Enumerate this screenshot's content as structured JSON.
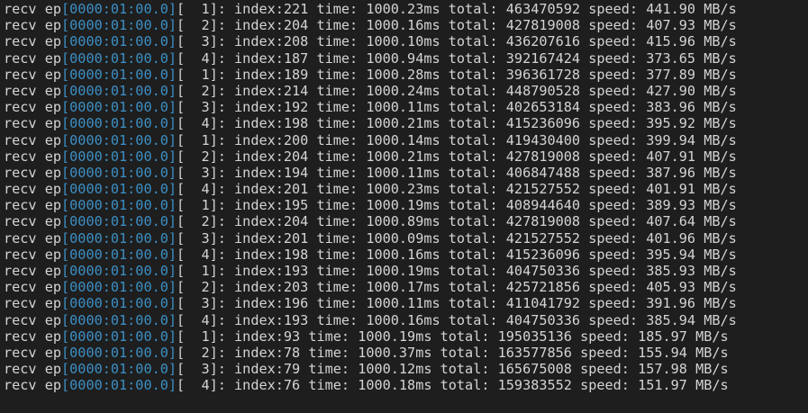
{
  "terminal": {
    "colors": {
      "background": "#1e1e1e",
      "text": "#d4d4d4",
      "bus_id": "#3c8fc4"
    },
    "lines": [
      {
        "prefix": "recv ep",
        "bus": "[0000:01:00.0]",
        "rest": "[  1]: index:221 time: 1000.23ms total: 463470592 speed: 441.90 MB/s"
      },
      {
        "prefix": "recv ep",
        "bus": "[0000:01:00.0]",
        "rest": "[  2]: index:204 time: 1000.16ms total: 427819008 speed: 407.93 MB/s"
      },
      {
        "prefix": "recv ep",
        "bus": "[0000:01:00.0]",
        "rest": "[  3]: index:208 time: 1000.10ms total: 436207616 speed: 415.96 MB/s"
      },
      {
        "prefix": "recv ep",
        "bus": "[0000:01:00.0]",
        "rest": "[  4]: index:187 time: 1000.94ms total: 392167424 speed: 373.65 MB/s"
      },
      {
        "prefix": "recv ep",
        "bus": "[0000:01:00.0]",
        "rest": "[  1]: index:189 time: 1000.28ms total: 396361728 speed: 377.89 MB/s"
      },
      {
        "prefix": "recv ep",
        "bus": "[0000:01:00.0]",
        "rest": "[  2]: index:214 time: 1000.24ms total: 448790528 speed: 427.90 MB/s"
      },
      {
        "prefix": "recv ep",
        "bus": "[0000:01:00.0]",
        "rest": "[  3]: index:192 time: 1000.11ms total: 402653184 speed: 383.96 MB/s"
      },
      {
        "prefix": "recv ep",
        "bus": "[0000:01:00.0]",
        "rest": "[  4]: index:198 time: 1000.21ms total: 415236096 speed: 395.92 MB/s"
      },
      {
        "prefix": "recv ep",
        "bus": "[0000:01:00.0]",
        "rest": "[  1]: index:200 time: 1000.14ms total: 419430400 speed: 399.94 MB/s"
      },
      {
        "prefix": "recv ep",
        "bus": "[0000:01:00.0]",
        "rest": "[  2]: index:204 time: 1000.21ms total: 427819008 speed: 407.91 MB/s"
      },
      {
        "prefix": "recv ep",
        "bus": "[0000:01:00.0]",
        "rest": "[  3]: index:194 time: 1000.11ms total: 406847488 speed: 387.96 MB/s"
      },
      {
        "prefix": "recv ep",
        "bus": "[0000:01:00.0]",
        "rest": "[  4]: index:201 time: 1000.23ms total: 421527552 speed: 401.91 MB/s"
      },
      {
        "prefix": "recv ep",
        "bus": "[0000:01:00.0]",
        "rest": "[  1]: index:195 time: 1000.19ms total: 408944640 speed: 389.93 MB/s"
      },
      {
        "prefix": "recv ep",
        "bus": "[0000:01:00.0]",
        "rest": "[  2]: index:204 time: 1000.89ms total: 427819008 speed: 407.64 MB/s"
      },
      {
        "prefix": "recv ep",
        "bus": "[0000:01:00.0]",
        "rest": "[  3]: index:201 time: 1000.09ms total: 421527552 speed: 401.96 MB/s"
      },
      {
        "prefix": "recv ep",
        "bus": "[0000:01:00.0]",
        "rest": "[  4]: index:198 time: 1000.16ms total: 415236096 speed: 395.94 MB/s"
      },
      {
        "prefix": "recv ep",
        "bus": "[0000:01:00.0]",
        "rest": "[  1]: index:193 time: 1000.19ms total: 404750336 speed: 385.93 MB/s"
      },
      {
        "prefix": "recv ep",
        "bus": "[0000:01:00.0]",
        "rest": "[  2]: index:203 time: 1000.17ms total: 425721856 speed: 405.93 MB/s"
      },
      {
        "prefix": "recv ep",
        "bus": "[0000:01:00.0]",
        "rest": "[  3]: index:196 time: 1000.11ms total: 411041792 speed: 391.96 MB/s"
      },
      {
        "prefix": "recv ep",
        "bus": "[0000:01:00.0]",
        "rest": "[  4]: index:193 time: 1000.16ms total: 404750336 speed: 385.94 MB/s"
      },
      {
        "prefix": "recv ep",
        "bus": "[0000:01:00.0]",
        "rest": "[  1]: index:93 time: 1000.19ms total: 195035136 speed: 185.97 MB/s"
      },
      {
        "prefix": "recv ep",
        "bus": "[0000:01:00.0]",
        "rest": "[  2]: index:78 time: 1000.37ms total: 163577856 speed: 155.94 MB/s"
      },
      {
        "prefix": "recv ep",
        "bus": "[0000:01:00.0]",
        "rest": "[  3]: index:79 time: 1000.12ms total: 165675008 speed: 157.98 MB/s"
      },
      {
        "prefix": "recv ep",
        "bus": "[0000:01:00.0]",
        "rest": "[  4]: index:76 time: 1000.18ms total: 159383552 speed: 151.97 MB/s"
      }
    ]
  }
}
